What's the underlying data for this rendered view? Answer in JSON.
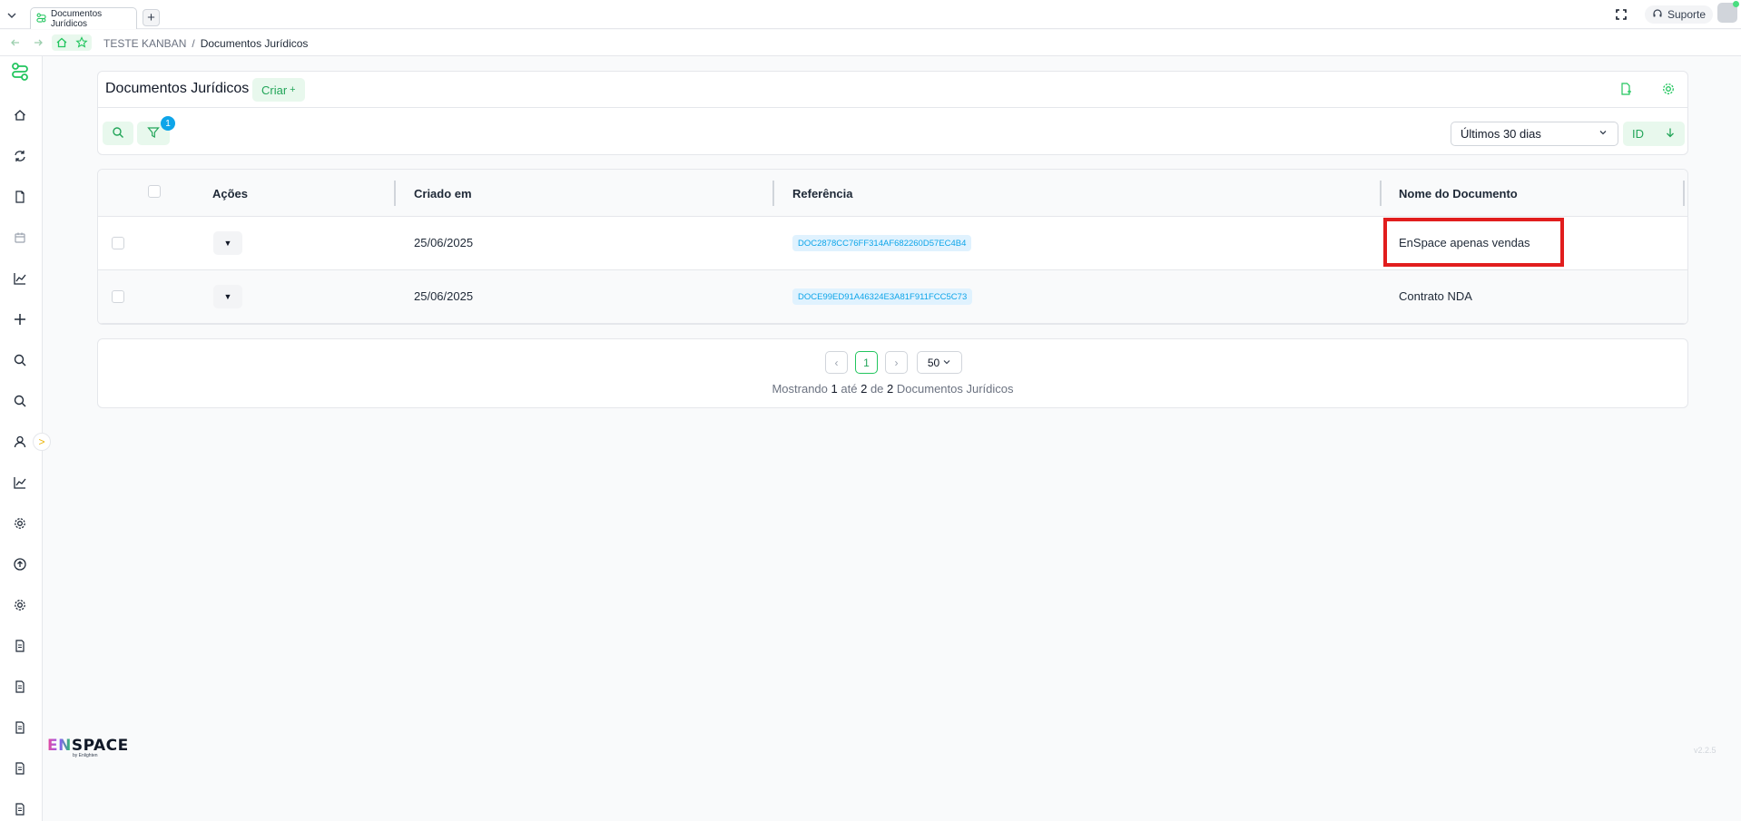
{
  "browser": {
    "tab_title": "Documentos Jurídicos",
    "new_tab_label": "+",
    "support_label": "Suporte"
  },
  "breadcrumb": {
    "items": [
      "TESTE KANBAN",
      "Documentos Jurídicos"
    ],
    "separator": "/"
  },
  "sidebar": {
    "icons": [
      "logo-icon",
      "home-icon",
      "sync-icon",
      "document-icon",
      "calendar-icon",
      "chart-icon",
      "plus-icon",
      "search-icon",
      "search-alt-icon",
      "user-icon",
      "chart-alt-icon",
      "settings-icon",
      "upload-icon",
      "settings-alt-icon",
      "file-icon",
      "file-alt-icon",
      "file-list-icon",
      "file-text-icon",
      "file-doc-icon"
    ],
    "expand_label": ">",
    "brand_prefix": "EN",
    "brand_suffix": "SPACE",
    "brand_sub": "by Enlighten",
    "version": "v2.2.5"
  },
  "header": {
    "title": "Documentos Jurídicos",
    "create_label": "Criar",
    "create_suffix": "+",
    "filter_count": "1",
    "period_value": "Últimos 30 dias",
    "sort_field": "ID"
  },
  "table": {
    "columns": [
      "Ações",
      "Criado em",
      "Referência",
      "Nome do Documento"
    ],
    "rows": [
      {
        "created": "25/06/2025",
        "reference": "DOC2878CC76FF314AF682260D57EC4B4",
        "name": "EnSpace apenas vendas"
      },
      {
        "created": "25/06/2025",
        "reference": "DOCE99ED91A46324E3A81F911FCC5C73",
        "name": "Contrato NDA"
      }
    ]
  },
  "pagination": {
    "prev": "‹",
    "current_page": "1",
    "next": "›",
    "per_page": "50",
    "summary_prefix": "Mostrando",
    "from": "1",
    "to_word": "até",
    "to": "2",
    "of_word": "de",
    "total": "2",
    "entity": "Documentos Jurídicos"
  },
  "colors": {
    "accent_green": "#22a559",
    "accent_green_bg": "#e8f8ed",
    "ref_chip_bg": "#e0f2fe",
    "ref_chip_text": "#0ea5e9",
    "highlight_red": "#e11d1d"
  }
}
